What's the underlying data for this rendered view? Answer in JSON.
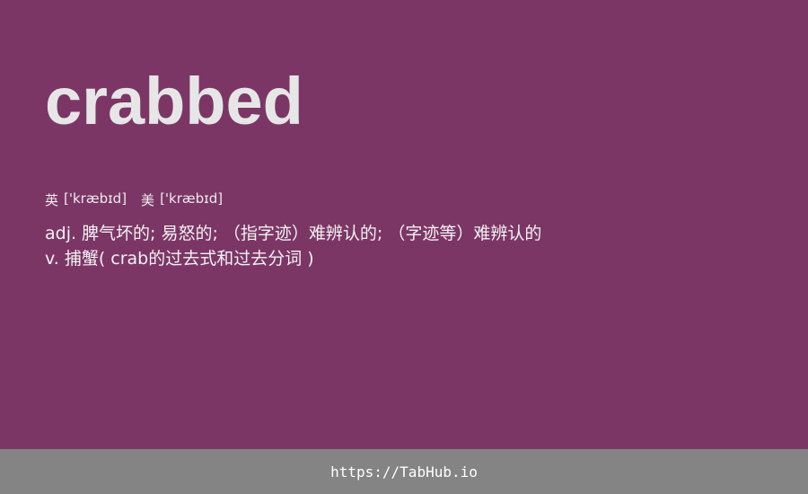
{
  "entry": {
    "word": "crabbed",
    "phonetics": {
      "uk_label": "英",
      "uk_ipa": "['kræbɪd]",
      "us_label": "美",
      "us_ipa": "['kræbɪd]"
    },
    "definitions": [
      {
        "pos": "adj.",
        "text": "脾气坏的; 易怒的; （指字迹）难辨认的; （字迹等）难辨认的"
      },
      {
        "pos": "v.",
        "text": "捕蟹( crab的过去式和过去分词 )"
      }
    ]
  },
  "footer": {
    "link_text": "https://TabHub.io"
  },
  "colors": {
    "background": "#7c3666",
    "footer_background": "#848484",
    "word_color": "#e6e6e6"
  }
}
